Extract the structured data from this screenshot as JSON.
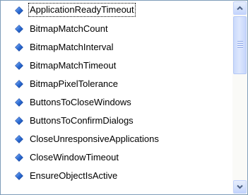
{
  "listbox": {
    "items": [
      {
        "label": "ApplicationReadyTimeout",
        "icon": "blue-diamond-icon",
        "focused": true
      },
      {
        "label": "BitmapMatchCount",
        "icon": "blue-diamond-icon"
      },
      {
        "label": "BitmapMatchInterval",
        "icon": "blue-diamond-icon"
      },
      {
        "label": "BitmapMatchTimeout",
        "icon": "blue-diamond-icon"
      },
      {
        "label": "BitmapPixelTolerance",
        "icon": "blue-diamond-icon"
      },
      {
        "label": "ButtonsToCloseWindows",
        "icon": "blue-diamond-icon"
      },
      {
        "label": "ButtonsToConfirmDialogs",
        "icon": "blue-diamond-icon"
      },
      {
        "label": "CloseUnresponsiveApplications",
        "icon": "blue-diamond-icon"
      },
      {
        "label": "CloseWindowTimeout",
        "icon": "blue-diamond-icon"
      },
      {
        "label": "EnsureObjectIsActive",
        "icon": "blue-diamond-icon"
      }
    ]
  },
  "scrollbar": {
    "up_icon": "chevron-up-icon",
    "down_icon": "chevron-down-icon",
    "position_fraction": 0.0
  },
  "colors": {
    "border": "#7f9db9",
    "icon_blue": "#2f6fd6",
    "scroll_button": "#c3d3fd"
  }
}
